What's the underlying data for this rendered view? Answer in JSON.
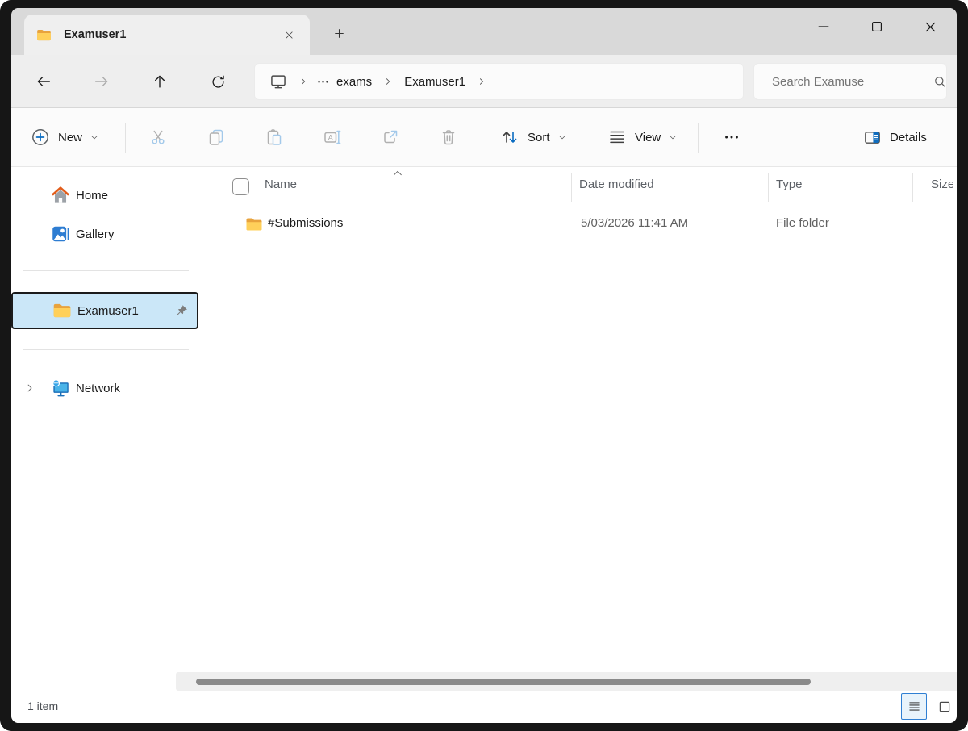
{
  "colors": {
    "accent_blue": "#0067c0",
    "titlebar_gray": "#d9d9d9",
    "selection_fill": "#cbe7f8",
    "folder_yellow": "#ffd05a",
    "disabled_icon_gray": "#b0b0b0",
    "disabled_icon_blue": "#a3c9ea"
  },
  "titlebar": {
    "tab_title": "Examuser1"
  },
  "navbar": {
    "breadcrumb": {
      "items": [
        {
          "label": "exams"
        },
        {
          "label": "Examuser1"
        }
      ]
    },
    "search_placeholder": "Search Examuse"
  },
  "toolbar": {
    "new_label": "New",
    "sort_label": "Sort",
    "view_label": "View",
    "details_label": "Details"
  },
  "sidebar": {
    "items": [
      {
        "label": "Home"
      },
      {
        "label": "Gallery"
      },
      {
        "label": "Examuser1",
        "selected": true,
        "pinned": true
      },
      {
        "label": "Network"
      }
    ]
  },
  "files": {
    "columns": {
      "name": "Name",
      "date_modified": "Date modified",
      "type": "Type",
      "size": "Size"
    },
    "rows": [
      {
        "name": "#Submissions",
        "date_modified": "5/03/2026 11:41 AM",
        "type": "File folder",
        "size": ""
      }
    ]
  },
  "statusbar": {
    "item_count": "1 item"
  },
  "icons": {
    "folder-icon": "yellow folder",
    "tab-close-icon": "x",
    "new-tab-icon": "+",
    "minimize-icon": "—",
    "maximize-icon": "□",
    "close-icon": "x",
    "back-icon": "left arrow",
    "forward-icon": "right arrow (disabled)",
    "up-icon": "up arrow",
    "refresh-icon": "circular arrow",
    "this-pc-icon": "monitor",
    "breadcrumb-chevron-icon": ">",
    "overflow-ellipsis-icon": "...",
    "search-icon": "magnifier",
    "new-plus-icon": "circled plus",
    "cut-icon": "scissors",
    "copy-icon": "two pages",
    "paste-icon": "clipboard",
    "rename-icon": "A with caret",
    "share-icon": "box with arrow",
    "delete-icon": "trash can",
    "sort-icon": "up-down arrows",
    "view-icon": "list lines",
    "more-icon": "three dots",
    "details-icon": "split panel",
    "home-icon": "house",
    "gallery-icon": "photo",
    "pin-icon": "pushpin",
    "network-icon": "networked monitor",
    "column-sort-caret-icon": "^",
    "details-view-icon": "list lines",
    "large-icons-view-icon": "square"
  }
}
